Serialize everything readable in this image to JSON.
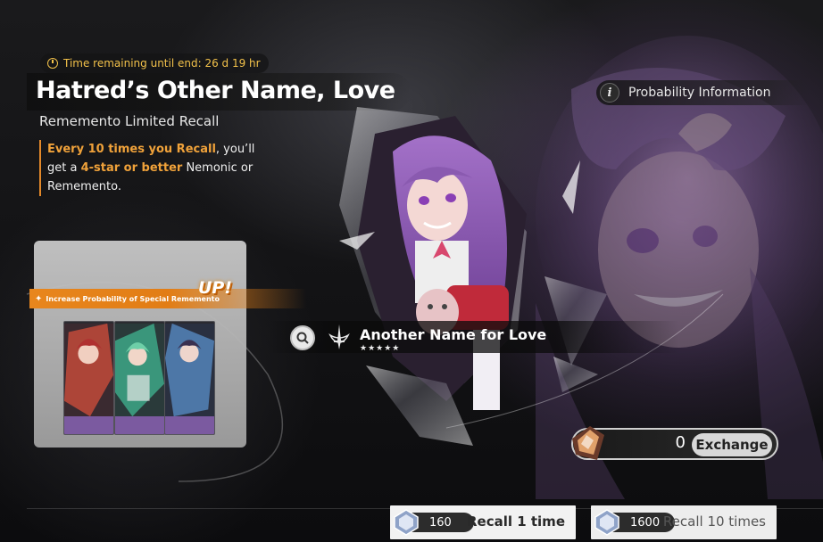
{
  "banner": {
    "timer_text": "Time remaining until end: 26 d 19 hr",
    "title": "Hatred’s Other Name, Love",
    "subtitle": "Rememento Limited Recall",
    "desc_hl1": "Every 10 times you Recall",
    "desc_t1": ", you’ll get a ",
    "desc_hl2": "4-star or better",
    "desc_t2": " Nemonic or Rememento."
  },
  "rate_up": {
    "banner_text": "Increase Probability of Special Rememento",
    "badge": "UP!",
    "cards": [
      {
        "name": "rememento-card-1",
        "accent": "#c24a3a"
      },
      {
        "name": "rememento-card-2",
        "accent": "#3fae8c"
      },
      {
        "name": "rememento-card-3",
        "accent": "#5a8fc9"
      }
    ]
  },
  "featured": {
    "name": "Another Name for Love",
    "stars": "★★★★★"
  },
  "probability": {
    "label": "Probability Information"
  },
  "exchange": {
    "count": "0",
    "label": "Exchange"
  },
  "recall": {
    "one": {
      "cost": "160",
      "label": "Recall 1 time"
    },
    "ten": {
      "cost": "1600",
      "label": "Recall 10 times"
    }
  },
  "colors": {
    "accent": "#f0a23a",
    "rate_banner": "#e8861d",
    "card_footer": "#7b5aa0"
  }
}
